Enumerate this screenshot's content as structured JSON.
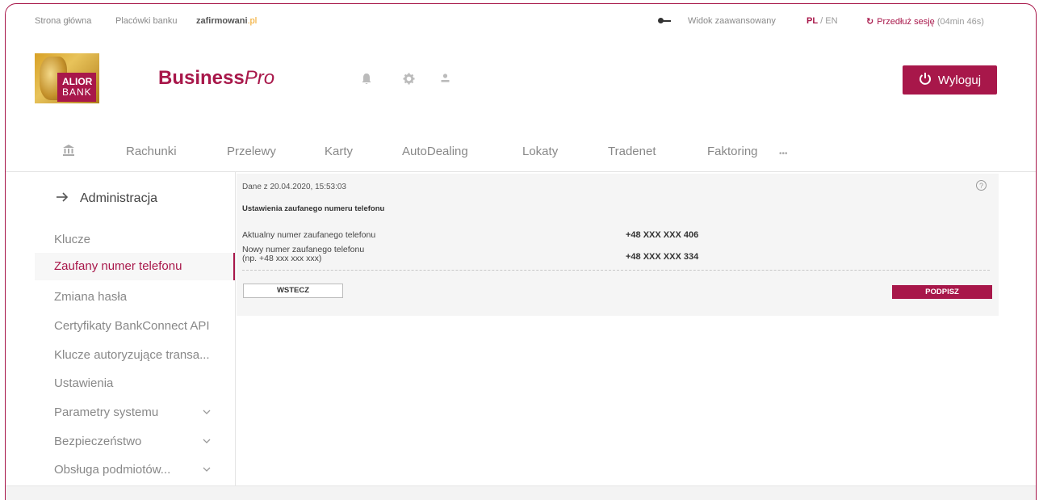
{
  "topbar": {
    "links": [
      "Strona główna",
      "Placówki banku"
    ],
    "brand_main": "zafirmowani",
    "brand_suffix": ".pl",
    "advanced_view": "Widok zaawansowany",
    "lang_active": "PL",
    "lang_sep": "/",
    "lang_other": "EN",
    "refresh_icon": "↻",
    "session_label": "Przedłuż sesję",
    "session_timer": "(04min 46s)"
  },
  "header": {
    "logo_line1": "ALIOR",
    "logo_line2": "BANK",
    "product_bold": "Business",
    "product_italic": "Pro",
    "logout_label": "Wyloguj"
  },
  "nav": {
    "items": [
      "Rachunki",
      "Przelewy",
      "Karty",
      "AutoDealing",
      "Lokaty",
      "Tradenet",
      "Faktoring"
    ],
    "more": "•••"
  },
  "sidebar": {
    "title": "Administracja",
    "items": [
      {
        "label": "Klucze"
      },
      {
        "label": "Zaufany numer telefonu",
        "active": true
      },
      {
        "label": "Zmiana hasła"
      },
      {
        "label": "Certyfikaty BankConnect API"
      },
      {
        "label": "Klucze autoryzujące transa..."
      },
      {
        "label": "Ustawienia"
      },
      {
        "label": "Parametry systemu",
        "expandable": true
      },
      {
        "label": "Bezpieczeństwo",
        "expandable": true
      },
      {
        "label": "Obsługa podmiotów...",
        "expandable": true
      }
    ]
  },
  "content": {
    "date": "Dane z 20.04.2020, 15:53:03",
    "help": "?",
    "section_title": "Ustawienia zaufanego numeru telefonu",
    "current_label": "Aktualny numer zaufanego telefonu",
    "current_value": "+48 XXX XXX 406",
    "new_label_line1": "Nowy numer zaufanego telefonu",
    "new_label_line2": "(np. +48 xxx xxx xxx)",
    "new_value": "+48 XXX XXX 334",
    "back_button": "WSTECZ",
    "sign_button": "PODPISZ"
  },
  "colors": {
    "brand": "#a8174a",
    "accent_gold": "#f0a21a"
  }
}
